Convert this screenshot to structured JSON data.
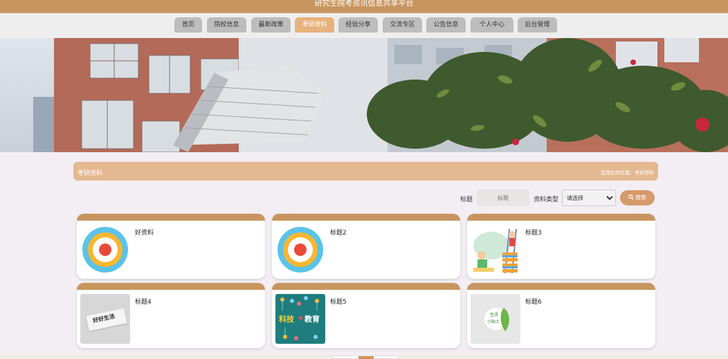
{
  "app": {
    "title": "研究生院考资讯信息共享平台"
  },
  "nav": {
    "items": [
      {
        "label": "首页",
        "active": false
      },
      {
        "label": "院校信息",
        "active": false
      },
      {
        "label": "最新政策",
        "active": false
      },
      {
        "label": "考研资料",
        "active": true
      },
      {
        "label": "经验分享",
        "active": false
      },
      {
        "label": "交流专区",
        "active": false
      },
      {
        "label": "公告信息",
        "active": false
      },
      {
        "label": "个人中心",
        "active": false
      },
      {
        "label": "后台管理",
        "active": false
      }
    ]
  },
  "section": {
    "title": "考研资料",
    "breadcrumb": "您现在的位置：考研资料"
  },
  "filter": {
    "title_label": "标题",
    "title_placeholder": "标题",
    "type_label": "资料类型",
    "type_selected": "请选择",
    "search_label": "搜索"
  },
  "cards": [
    {
      "title": "好资料",
      "image": "circular-diagram"
    },
    {
      "title": "标题2",
      "image": "circular-diagram"
    },
    {
      "title": "标题3",
      "image": "kids-reading-books"
    },
    {
      "title": "标题4",
      "image": "good-life-paper"
    },
    {
      "title": "标题5",
      "image": "science-education-board"
    },
    {
      "title": "标题6",
      "image": "leaf-life-tips"
    }
  ],
  "thumb_text": {
    "good_life": "好好生活",
    "science": "科技",
    "plus": "+",
    "education": "教育",
    "life": "生活",
    "tips": "小贴士"
  },
  "colors": {
    "brand": "#c8955f",
    "nav_active": "#e7b27d",
    "nav_inactive": "#bdbdbd",
    "section_bar": "#e4b890",
    "search_button": "#d79a6b",
    "page_bg": "#f3eef3"
  }
}
